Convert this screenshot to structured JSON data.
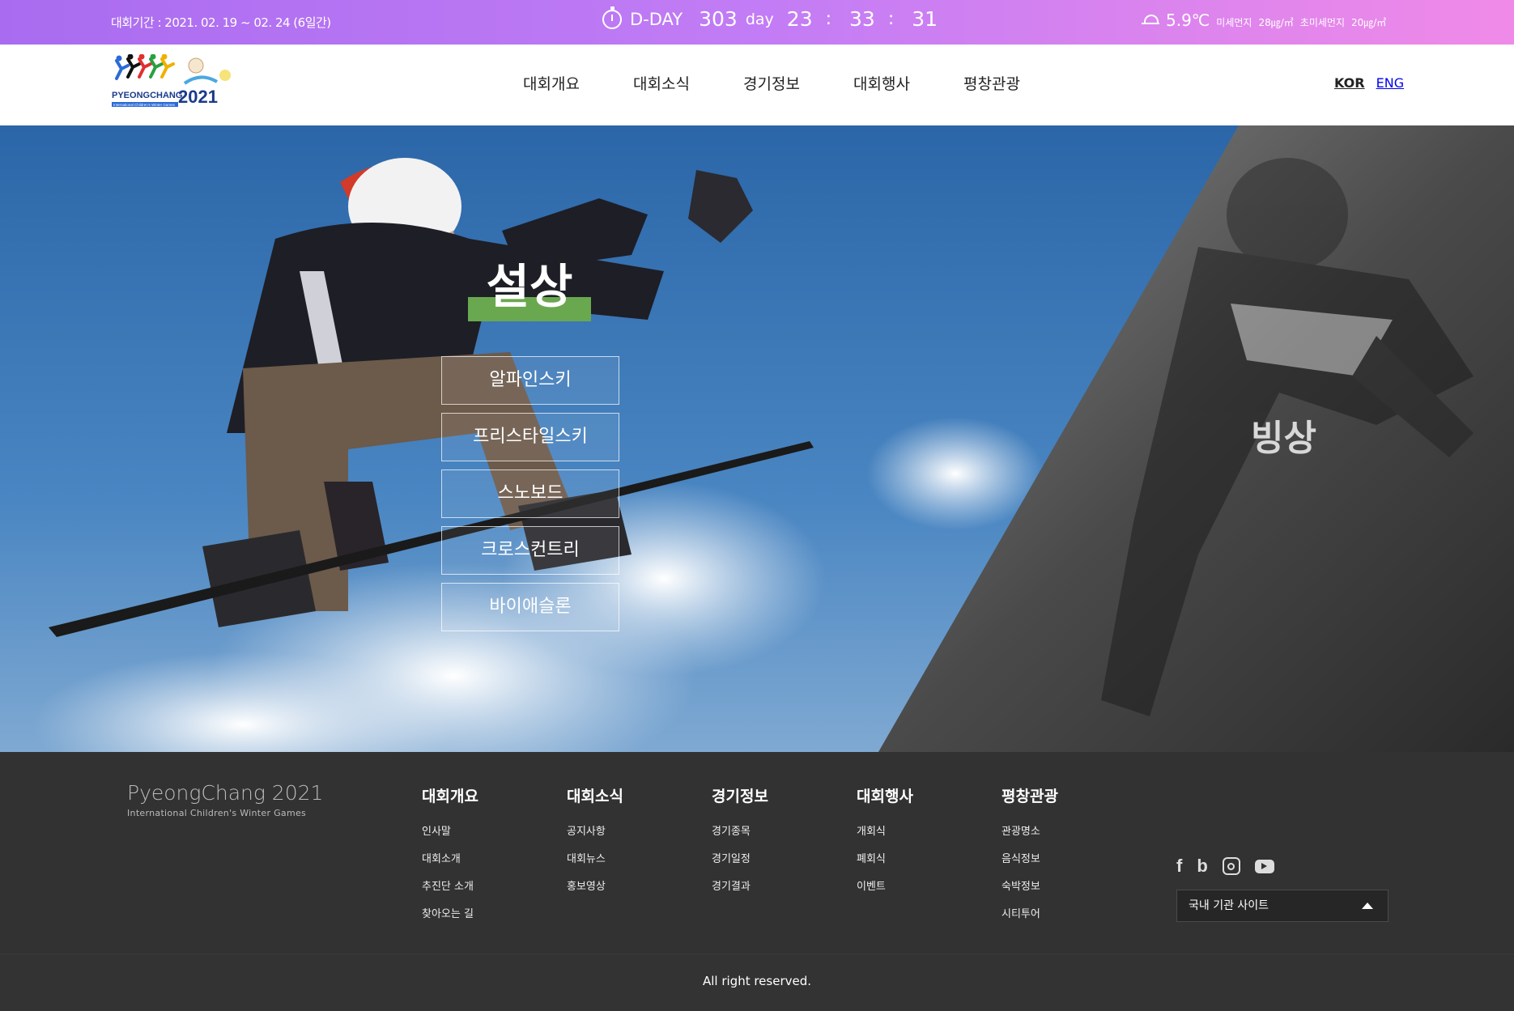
{
  "topbar": {
    "period": "대회기간 : 2021. 02. 19 ~ 02. 24 (6일간)",
    "dday_label": "D-DAY",
    "dday_count": "303",
    "dday_unit": "day",
    "hours": "23",
    "minutes": "33",
    "seconds": "31",
    "separator": ":",
    "temperature": "5.9℃",
    "fine_dust_label": "미세먼지",
    "fine_dust_value": "28㎍/㎥",
    "ultrafine_dust_label": "초미세먼지",
    "ultrafine_dust_value": "20㎍/㎥",
    "weather_icon": "cloud-icon"
  },
  "header": {
    "logo_text": "PYEONGCHANG",
    "logo_year": "2021",
    "logo_sub": "International Children's Winter Games",
    "nav": [
      "대회개요",
      "대회소식",
      "경기정보",
      "대회행사",
      "평창관광"
    ],
    "lang_kor": "KOR",
    "lang_eng": "ENG"
  },
  "hero": {
    "snow_title": "설상",
    "snow_sports": [
      "알파인스키",
      "프리스타일스키",
      "스노보드",
      "크로스컨트리",
      "바이애슬론"
    ],
    "ice_title": "빙상",
    "accent_color": "#6aa84f"
  },
  "footer": {
    "brand_title": "PyeongChang 2021",
    "brand_sub": "International Children's Winter Games",
    "columns": [
      {
        "title": "대회개요",
        "links": [
          "인사말",
          "대회소개",
          "추진단 소개",
          "찾아오는 길"
        ]
      },
      {
        "title": "대회소식",
        "links": [
          "공지사항",
          "대회뉴스",
          "홍보영상"
        ]
      },
      {
        "title": "경기정보",
        "links": [
          "경기종목",
          "경기일정",
          "경기결과"
        ]
      },
      {
        "title": "대회행사",
        "links": [
          "개회식",
          "폐회식",
          "이벤트"
        ]
      },
      {
        "title": "평창관광",
        "links": [
          "관광명소",
          "음식정보",
          "숙박정보",
          "시티투어"
        ]
      }
    ],
    "social_icons": [
      "facebook-icon",
      "blog-icon",
      "instagram-icon",
      "youtube-icon"
    ],
    "site_select": "국내 기관 사이트",
    "copyright": "All right reserved."
  }
}
